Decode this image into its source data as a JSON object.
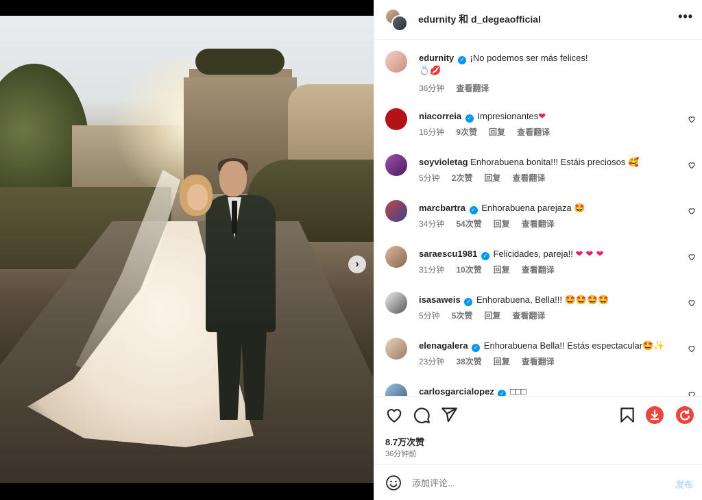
{
  "header": {
    "title": "edurnity 和 d_degeaofficial"
  },
  "caption": {
    "user": "edurnity",
    "text": "¡No podemos ser más felices!",
    "emojis": "💍💋",
    "time": "36分钟",
    "translate": "查看翻译"
  },
  "comments": [
    {
      "user": "niacorreia",
      "verified": true,
      "text": "Impresionantes",
      "emoji": "❤",
      "time": "16分钟",
      "likes": "9次赞",
      "reply": "回复",
      "translate": "查看翻译",
      "avatar_color": "#b31217"
    },
    {
      "user": "soyvioletag",
      "verified": false,
      "text": "Enhorabuena bonita!!! Estáis preciosos",
      "emoji": "🥰",
      "time": "5分钟",
      "likes": "2次赞",
      "reply": "回复",
      "translate": "查看翻译",
      "avatar_color": "#7a3b8f"
    },
    {
      "user": "marcbartra",
      "verified": true,
      "text": "Enhorabuena parejaza",
      "emoji": "🤩",
      "time": "34分钟",
      "likes": "54次赞",
      "reply": "回复",
      "translate": "查看翻译",
      "avatar_color": "#a03030"
    },
    {
      "user": "saraescu1981",
      "verified": true,
      "text": "Felicidades, pareja!!",
      "emoji": "❤ ❤ ❤",
      "time": "31分钟",
      "likes": "10次赞",
      "reply": "回复",
      "translate": "查看翻译",
      "avatar_color": "#b58a6a"
    },
    {
      "user": "isasaweis",
      "verified": true,
      "text": "Enhorabuena, Bella!!!",
      "emoji": "🤩🤩🤩🤩",
      "time": "5分钟",
      "likes": "5次赞",
      "reply": "回复",
      "translate": "查看翻译",
      "avatar_color": "#6a6a6a"
    },
    {
      "user": "elenagalera",
      "verified": true,
      "text": "Enhorabuena Bella!! Estás espectacular",
      "emoji": "🤩✨",
      "time": "23分钟",
      "likes": "38次赞",
      "reply": "回复",
      "translate": "查看翻译",
      "avatar_color": "#c9a88c"
    },
    {
      "user": "carlosgarcialopez",
      "verified": true,
      "text": "",
      "emoji": "□□□",
      "time": "",
      "likes": "",
      "reply": "",
      "translate": "",
      "avatar_color": "#5a7ea0"
    }
  ],
  "actions": {
    "likes": "8.7万次赞",
    "posted": "36分钟前"
  },
  "comment_box": {
    "placeholder": "添加评论...",
    "post_label": "发布"
  },
  "icons": {
    "more": "more-icon",
    "like": "heart-icon",
    "comment": "comment-icon",
    "share": "share-icon",
    "save": "bookmark-icon",
    "download": "download-icon",
    "refresh": "refresh-icon",
    "emoji": "smile-icon",
    "next": "chevron-right-icon"
  },
  "colors": {
    "accent": "#0095f6",
    "download": "#e8463f",
    "refresh": "#e8463f"
  },
  "carousel": {
    "total": 3,
    "active": 1
  }
}
